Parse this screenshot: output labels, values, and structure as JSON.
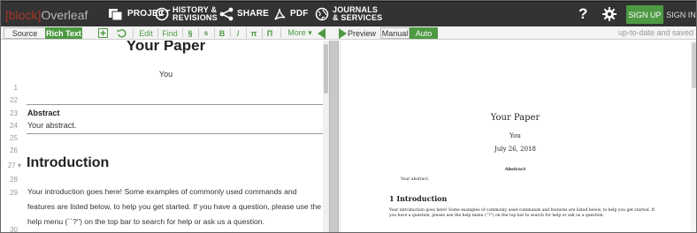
{
  "topbar": {
    "brand": {
      "bracket": "[block]",
      "name": "Overleaf"
    },
    "items": [
      {
        "label": "PROJECT",
        "icon": "project-icon"
      },
      {
        "label": "HISTORY &\nREVISIONS",
        "icon": "history-icon"
      },
      {
        "label": "SHARE",
        "icon": "share-icon"
      },
      {
        "label": "PDF",
        "icon": "pdf-icon"
      },
      {
        "label": "JOURNALS\n& SERVICES",
        "icon": "globe-icon"
      }
    ],
    "help": "?",
    "signup": "SIGN UP",
    "signin": "SIGN IN"
  },
  "toolbar": {
    "source": "Source",
    "rich_text": "Rich Text",
    "edit": "Edit",
    "find": "Find",
    "section": "§",
    "subsection": "s",
    "bold": "B",
    "italic": "I",
    "pi": "π",
    "pi_upper": "Π",
    "more": "More ▾",
    "preview": "Preview",
    "manual": "Manual",
    "auto": "Auto",
    "status": "up-to-date and saved"
  },
  "editor": {
    "title": "Your Paper",
    "author": "You",
    "line_numbers": {
      "l1": "1",
      "l22": "22",
      "l23": "23",
      "l24": "24",
      "l25": "25",
      "l26": "26",
      "l27": "27 ▾",
      "l28": "28",
      "l29": "29",
      "l30": "30"
    },
    "abstract_label": "Abstract",
    "abstract_body": "Your abstract.",
    "section_title": "Introduction",
    "intro_text": "Your introduction goes here! Some examples of commonly used commands and features are listed below, to help you get started. If you have a question, please use the help menu (``?'') on the top bar to search for help or ask us a question."
  },
  "pdf": {
    "title": "Your Paper",
    "author": "You",
    "date": "July 26, 2018",
    "abstract_heading": "Abstract",
    "abstract": "Your abstract.",
    "section": "1   Introduction",
    "body": "Your introduction goes here! Some examples of commonly used commands and features are listed below, to help you get started. If you have a question, please use the help menu (“?”) on the top bar to search for help or ask us a question."
  },
  "colors": {
    "topbar_bg": "#333333",
    "accent_green": "#4e9a43",
    "brand_red": "#a93529"
  }
}
